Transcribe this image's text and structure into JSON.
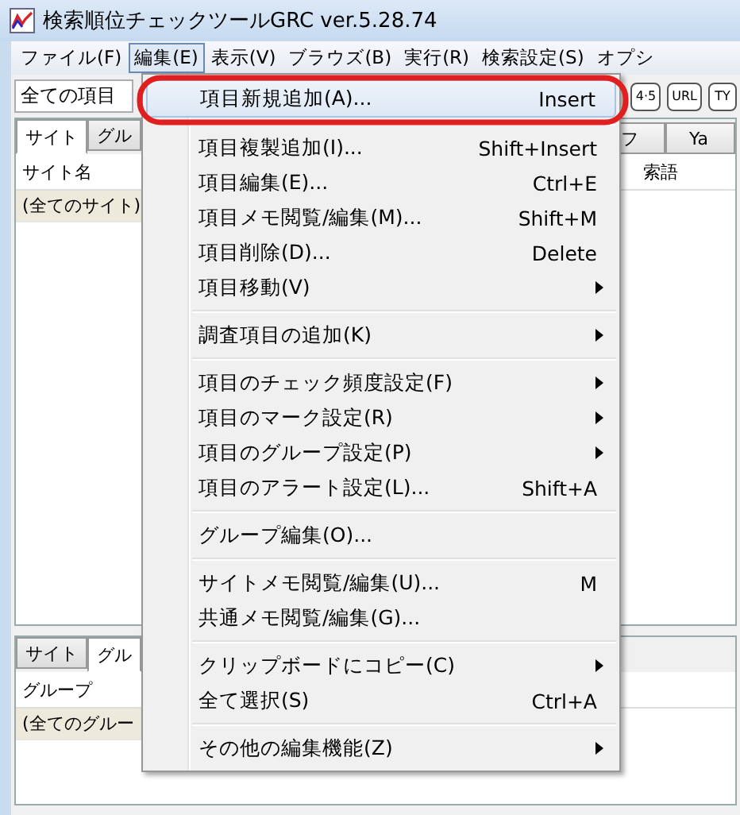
{
  "window": {
    "title": "検索順位チェックツールGRC  ver.5.28.74"
  },
  "menubar": [
    {
      "label": "ファイル(F)",
      "selected": false
    },
    {
      "label": "編集(E)",
      "selected": true
    },
    {
      "label": "表示(V)",
      "selected": false
    },
    {
      "label": "ブラウズ(B)",
      "selected": false
    },
    {
      "label": "実行(R)",
      "selected": false
    },
    {
      "label": "検索設定(S)",
      "selected": false
    },
    {
      "label": "オプシ",
      "selected": false
    }
  ],
  "toolbar": {
    "filter": {
      "value": "全ての項目"
    },
    "buttons": [
      "4·5",
      "URL",
      "TY"
    ]
  },
  "upper_panel": {
    "tabs": [
      {
        "label": "サイト",
        "selected": true
      },
      {
        "label": "グル",
        "selected": false
      }
    ],
    "right_tabs": [
      {
        "label": "フ",
        "selected": false
      },
      {
        "label": "Ya",
        "selected": false
      }
    ],
    "columns": [
      "サイト名",
      "索語"
    ],
    "rows": [
      {
        "cells": [
          "(全てのサイト)"
        ],
        "selected": true
      }
    ]
  },
  "lower_panel": {
    "tabs": [
      {
        "label": "サイト",
        "selected": false
      },
      {
        "label": "グル",
        "selected": true
      }
    ],
    "columns": [
      "グループ"
    ],
    "rows": [
      {
        "cells": [
          "(全てのグルー"
        ],
        "selected": true
      }
    ]
  },
  "edit_menu": [
    {
      "kind": "item",
      "label": "項目新規追加(A)...",
      "shortcut": "Insert",
      "submenu": false,
      "selected": true,
      "circled": true
    },
    {
      "kind": "separator"
    },
    {
      "kind": "item",
      "label": "項目複製追加(I)...",
      "shortcut": "Shift+Insert",
      "submenu": false,
      "selected": false,
      "circled": false
    },
    {
      "kind": "item",
      "label": "項目編集(E)...",
      "shortcut": "Ctrl+E",
      "submenu": false,
      "selected": false,
      "circled": false
    },
    {
      "kind": "item",
      "label": "項目メモ閲覧/編集(M)...",
      "shortcut": "Shift+M",
      "submenu": false,
      "selected": false,
      "circled": false
    },
    {
      "kind": "item",
      "label": "項目削除(D)...",
      "shortcut": "Delete",
      "submenu": false,
      "selected": false,
      "circled": false
    },
    {
      "kind": "item",
      "label": "項目移動(V)",
      "submenu": true,
      "selected": false,
      "circled": false
    },
    {
      "kind": "separator"
    },
    {
      "kind": "item",
      "label": "調査項目の追加(K)",
      "submenu": true,
      "selected": false,
      "circled": false
    },
    {
      "kind": "separator"
    },
    {
      "kind": "item",
      "label": "項目のチェック頻度設定(F)",
      "submenu": true,
      "selected": false,
      "circled": false
    },
    {
      "kind": "item",
      "label": "項目のマーク設定(R)",
      "submenu": true,
      "selected": false,
      "circled": false
    },
    {
      "kind": "item",
      "label": "項目のグループ設定(P)",
      "submenu": true,
      "selected": false,
      "circled": false
    },
    {
      "kind": "item",
      "label": "項目のアラート設定(L)...",
      "shortcut": "Shift+A",
      "submenu": false,
      "selected": false,
      "circled": false
    },
    {
      "kind": "separator"
    },
    {
      "kind": "item",
      "label": "グループ編集(O)...",
      "submenu": false,
      "selected": false,
      "circled": false
    },
    {
      "kind": "separator"
    },
    {
      "kind": "item",
      "label": "サイトメモ閲覧/編集(U)...",
      "shortcut": "M",
      "submenu": false,
      "selected": false,
      "circled": false
    },
    {
      "kind": "item",
      "label": "共通メモ閲覧/編集(G)...",
      "submenu": false,
      "selected": false,
      "circled": false
    },
    {
      "kind": "separator"
    },
    {
      "kind": "item",
      "label": "クリップボードにコピー(C)",
      "submenu": true,
      "selected": false,
      "circled": false
    },
    {
      "kind": "item",
      "label": "全て選択(S)",
      "shortcut": "Ctrl+A",
      "submenu": false,
      "selected": false,
      "circled": false
    },
    {
      "kind": "separator"
    },
    {
      "kind": "item",
      "label": "その他の編集機能(Z)",
      "submenu": true,
      "selected": false,
      "circled": false
    }
  ]
}
